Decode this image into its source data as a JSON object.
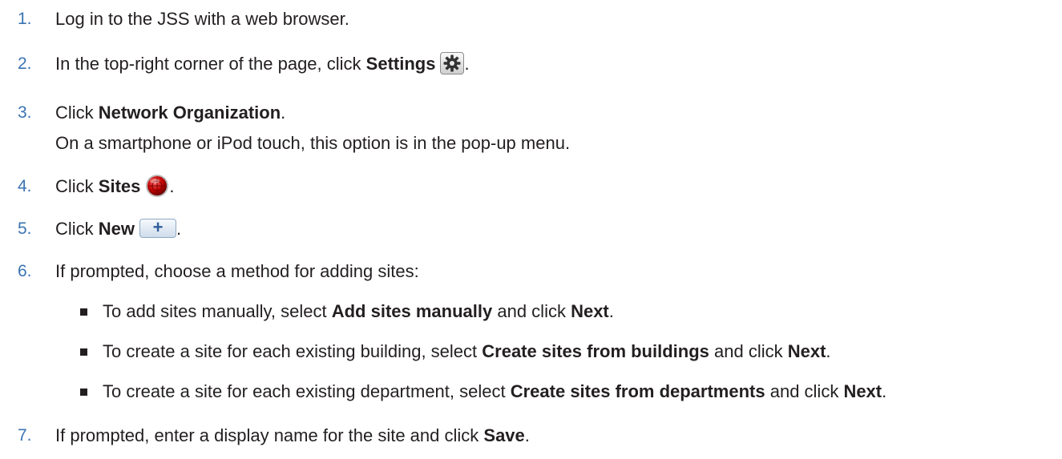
{
  "steps": [
    {
      "num": "1.",
      "text": "Log in to the JSS with a web browser."
    },
    {
      "num": "2.",
      "pre": "In the top-right corner of the page, click ",
      "bold": "Settings",
      "post": "."
    },
    {
      "num": "3.",
      "pre": "Click ",
      "bold": "Network Organization",
      "post": ".",
      "note": "On a smartphone or iPod touch, this option is in the pop-up menu."
    },
    {
      "num": "4.",
      "pre": "Click ",
      "bold": "Sites",
      "post": "."
    },
    {
      "num": "5.",
      "pre": "Click ",
      "bold": "New",
      "post": "."
    },
    {
      "num": "6.",
      "text": "If prompted, choose a method for adding sites:",
      "bullets": [
        {
          "pre": "To add sites manually, select ",
          "bold1": "Add sites manually",
          "mid": " and click ",
          "bold2": "Next",
          "post": "."
        },
        {
          "pre": "To create a site for each existing building, select ",
          "bold1": "Create sites from buildings",
          "mid": " and click ",
          "bold2": "Next",
          "post": "."
        },
        {
          "pre": "To create a site for each existing department, select ",
          "bold1": "Create sites from departments",
          "mid": " and click ",
          "bold2": "Next",
          "post": "."
        }
      ]
    },
    {
      "num": "7.",
      "pre": "If prompted, enter a display name for the site and click ",
      "bold": "Save",
      "post": "."
    }
  ],
  "icons": {
    "settings": "gear-icon",
    "sites": "sites-icon",
    "new": "plus-icon",
    "new_glyph": "+"
  },
  "colors": {
    "step_number": "#3a74b3",
    "text": "#231f20"
  }
}
